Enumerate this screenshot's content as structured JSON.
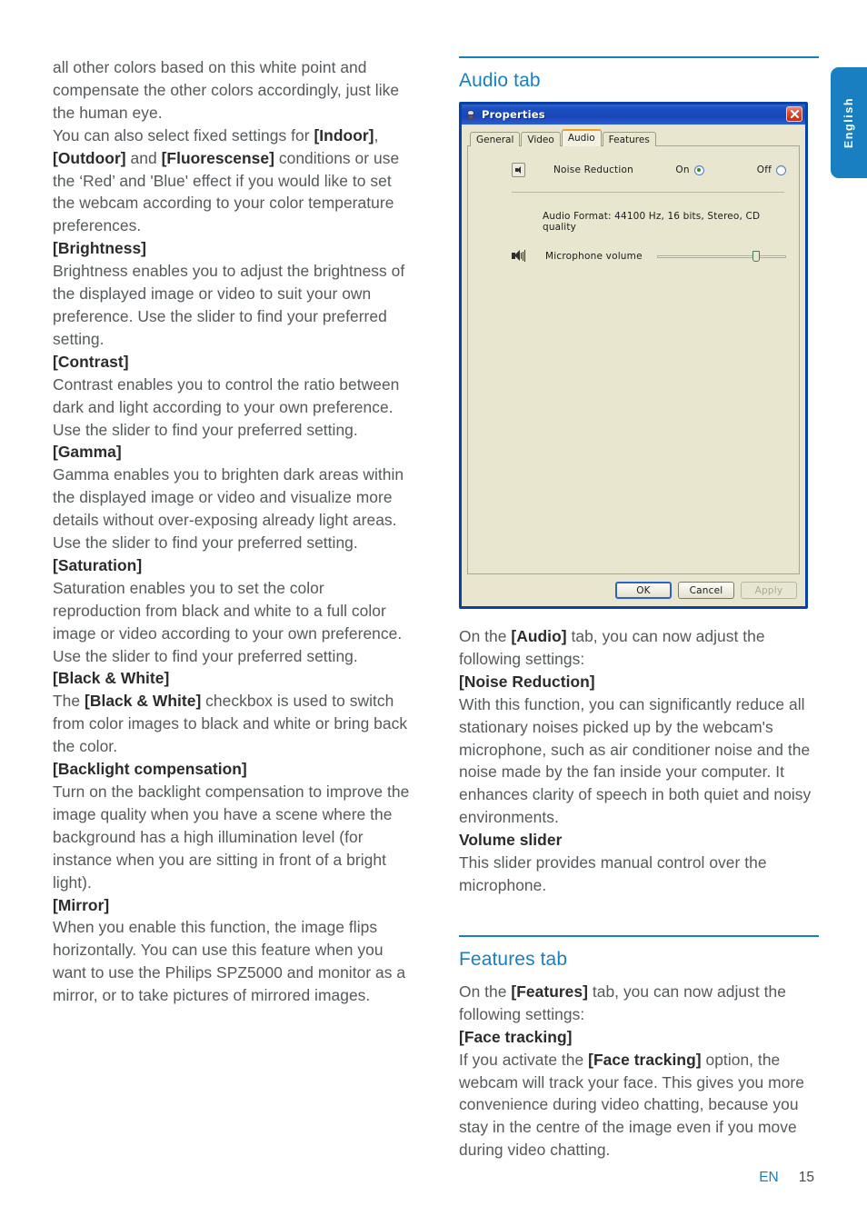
{
  "language_tab": {
    "label": "English"
  },
  "footer": {
    "lang_code": "EN",
    "page_number": "15"
  },
  "left_column": {
    "paragraphs": [
      "all other colors based on this white point and compensate the other colors accordingly, just like the human eye.",
      "You can also select fixed settings for [Indoor], [Outdoor] and [Fluorescense] conditions or use the 'Red' and 'Blue' effect if you would like to set the webcam according to your color temperature preferences.",
      "[Brightness]",
      "Brightness enables you to adjust the brightness of the displayed image or video to suit your own preference. Use the slider to find your preferred setting.",
      "[Contrast]",
      "Contrast enables you to control the ratio between dark and light according to your own preference. Use the slider to find your preferred setting.",
      "[Gamma]",
      "Gamma enables you to brighten dark areas within the displayed image or video and visualize more details without over-exposing already light areas. Use the slider to find your preferred setting.",
      "[Saturation]",
      "Saturation enables you to set the color reproduction from black and white to a full color image or video according to your own preference. Use the slider to find your preferred setting.",
      "[Black & White]",
      "The [Black & White] checkbox is used to switch from color images to black and white or bring back the color.",
      "[Backlight compensation]",
      "Turn on the backlight compensation to improve the image quality when you have a scene where the background has a high illumination level (for instance when you are sitting in front of a bright light).",
      "[Mirror]",
      "When you enable this function, the image flips horizontally. You can use this feature when you want to use the Philips SPZ5000 and monitor as a mirror, or to take pictures of mirrored images."
    ],
    "p1": "all other colors based on this white point and compensate the other colors accordingly, just like the human eye.",
    "p2_a": "You can also select fixed settings for ",
    "p2_b1": "[Indoor]",
    "p2_c": ", ",
    "p2_b2": "[Outdoor]",
    "p2_d": " and ",
    "p2_b3": "[Fluorescense]",
    "p2_e": " conditions or use the ‘Red’ and 'Blue' effect if you would like to set the webcam according to your color temperature preferences.",
    "h_brightness": "[Brightness]",
    "p_brightness": "Brightness enables you to adjust the brightness of the displayed image or video to suit your own preference. Use the slider to find your preferred setting.",
    "h_contrast": "[Contrast]",
    "p_contrast": "Contrast enables you to control the ratio between dark and light according to your own preference. Use the slider to find your preferred setting.",
    "h_gamma": "[Gamma]",
    "p_gamma": "Gamma enables you to brighten dark areas within the displayed image or video and visualize more details without over-exposing already light areas. Use the slider to find your preferred setting.",
    "h_saturation": "[Saturation]",
    "p_saturation": "Saturation enables you to set the color reproduction from black and white to a full color image or video according to your own preference. Use the slider to find your preferred setting.",
    "h_bw": "[Black & White]",
    "p_bw_a": "The ",
    "p_bw_b": "[Black & White]",
    "p_bw_c": " checkbox is used to switch from color images to black and white or bring back the color.",
    "h_backlight": "[Backlight compensation]",
    "p_backlight": "Turn on the backlight compensation to improve the image quality when you have a scene where the background has a high illumination level (for instance when you are sitting in front of a bright light).",
    "h_mirror": "[Mirror]",
    "p_mirror": "When you enable this function, the image flips horizontally. You can use this feature when you want to use the Philips SPZ5000 and monitor as a mirror, or to take pictures of mirrored images."
  },
  "right_column": {
    "audio_section": {
      "heading": "Audio tab",
      "intro_a": "On the ",
      "intro_b": "[Audio]",
      "intro_c": " tab, you can now adjust the following settings:",
      "h_noise": "[Noise Reduction]",
      "p_noise": "With this function, you can significantly reduce all stationary noises picked up by the webcam's microphone, such as air conditioner noise and the noise made by the fan inside your computer. It enhances clarity of speech in both quiet and noisy environments.",
      "h_volume": "Volume slider",
      "p_volume": "This slider provides manual control over the microphone."
    },
    "features_section": {
      "heading": "Features tab",
      "intro_a": "On the ",
      "intro_b": "[Features]",
      "intro_c": " tab, you can now adjust the following settings:",
      "h_face": "[Face tracking]",
      "p_face_a": "If you activate the ",
      "p_face_b": "[Face tracking]",
      "p_face_c": " option, the webcam will track your face. This gives you more convenience during video chatting, because you stay in the centre of the image even if you move during video chatting."
    }
  },
  "dialog": {
    "title": "Properties",
    "title_icon": "webcam-icon",
    "close_icon": "close-icon",
    "tabs": [
      {
        "label": "General",
        "active": false
      },
      {
        "label": "Video",
        "active": false
      },
      {
        "label": "Audio",
        "active": true
      },
      {
        "label": "Features",
        "active": false
      }
    ],
    "tab_general": "General",
    "tab_video": "Video",
    "tab_audio": "Audio",
    "tab_features": "Features",
    "noise_reduction": {
      "label": "Noise Reduction",
      "on_label": "On",
      "off_label": "Off",
      "selected": "On",
      "icon": "speaker-small-icon"
    },
    "audio_format": "Audio Format: 44100 Hz, 16 bits, Stereo, CD quality",
    "microphone": {
      "label": "Microphone volume",
      "icon": "speaker-icon",
      "value_percent": "74"
    },
    "buttons": {
      "ok": "OK",
      "cancel": "Cancel",
      "apply": "Apply"
    }
  },
  "colors": {
    "accent_blue": "#1a7fc1",
    "body_text": "#55595c",
    "bold_text": "#2b2b2b",
    "dialog_bg": "#e8e6cf",
    "dialog_border": "#0a41a8",
    "titlebar_blue": "#1c4fc0",
    "radio_dot_green": "#2e8b2e",
    "close_red": "#c42d12",
    "active_tab_orange": "#f0a020"
  }
}
